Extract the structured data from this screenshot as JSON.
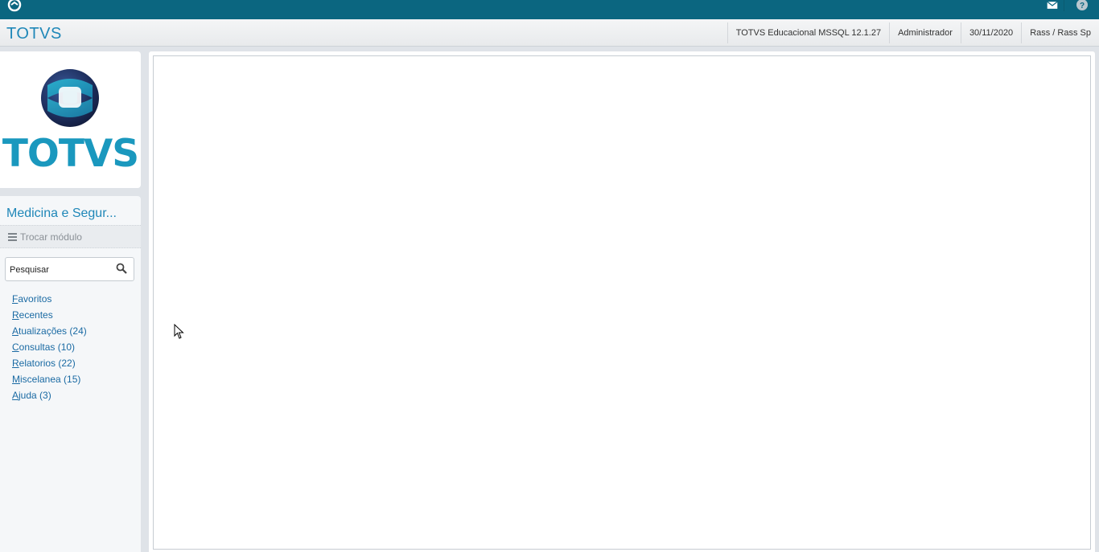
{
  "topbar": {
    "icons": [
      "app-logo-icon",
      "mail-icon",
      "help-icon"
    ],
    "color": "#0b6680"
  },
  "header": {
    "brand": "TOTVS",
    "environment": "TOTVS Educacional MSSQL 12.1.27",
    "user": "Administrador",
    "date": "30/11/2020",
    "company": "Rass / Rass Sp"
  },
  "logo": {
    "text": "TOTVS",
    "color": "#1a98be"
  },
  "sidebar": {
    "module_title": "Medicina e Segur...",
    "swap_module": "Trocar módulo",
    "search": {
      "placeholder": "Pesquisar"
    },
    "items": [
      {
        "first": "F",
        "rest": "avoritos",
        "count": ""
      },
      {
        "first": "R",
        "rest": "ecentes",
        "count": ""
      },
      {
        "first": "A",
        "rest": "tualizações",
        "count": " (24)"
      },
      {
        "first": "C",
        "rest": "onsultas",
        "count": " (10)"
      },
      {
        "first": "R",
        "rest": "elatorios",
        "count": " (22)"
      },
      {
        "first": "M",
        "rest": "iscelanea",
        "count": " (15)"
      },
      {
        "first": "A",
        "rest": "juda",
        "count": " (3)"
      }
    ]
  },
  "colors": {
    "accent": "#1f87b8",
    "link": "#1a6aa3"
  }
}
